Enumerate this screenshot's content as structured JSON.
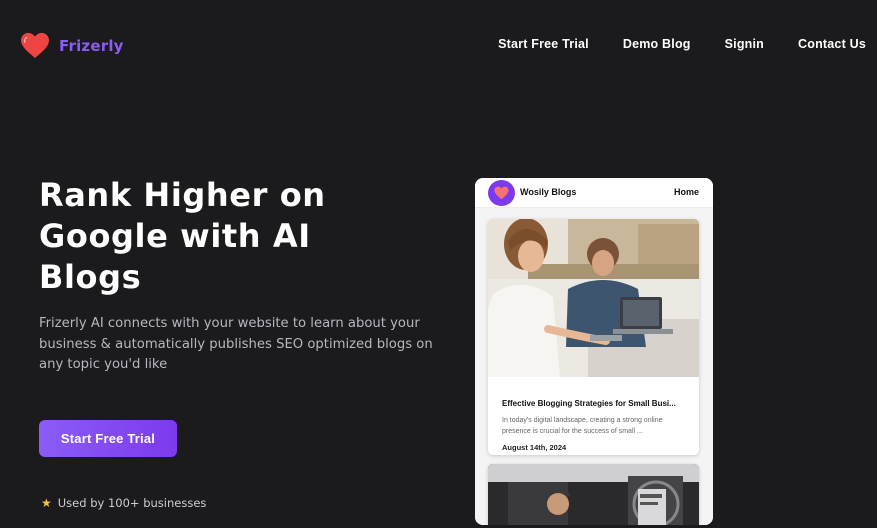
{
  "brand": {
    "name": "Frizerly",
    "logo_icon": "heart-icon",
    "accent_color": "#8b5cf6",
    "logo_color": "#ef4444"
  },
  "nav": {
    "links": [
      {
        "label": "Start Free Trial"
      },
      {
        "label": "Demo Blog"
      },
      {
        "label": "Signin"
      },
      {
        "label": "Contact Us"
      }
    ]
  },
  "hero": {
    "title": "Rank Higher on Google with AI Blogs",
    "description": "Frizerly AI connects with your website to learn about your business & automatically publishes SEO optimized blogs on any topic you'd like",
    "cta_label": "Start Free Trial",
    "social_proof_icon": "star-icon",
    "social_proof": "Used by 100+ businesses"
  },
  "preview": {
    "brand": "Wosily Blogs",
    "home_label": "Home",
    "post": {
      "title": "Effective Blogging Strategies for Small Busi...",
      "excerpt": "In today's digital landscape, creating a strong online presence is crucial for the success of small ...",
      "date": "August 14th, 2024"
    }
  }
}
